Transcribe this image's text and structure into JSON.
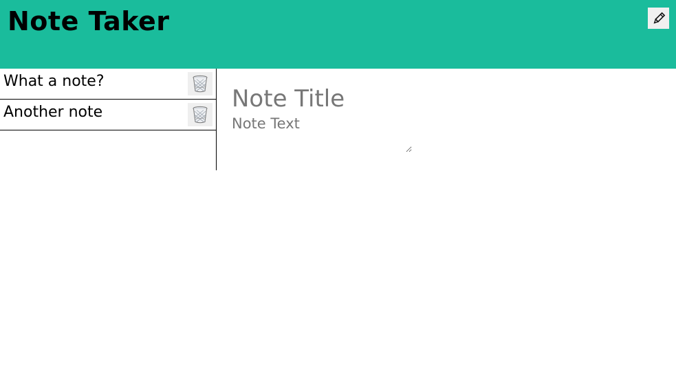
{
  "header": {
    "title": "Note Taker",
    "new_note_icon": "pencil-icon",
    "background": "#1abc9c"
  },
  "sidebar": {
    "notes": [
      {
        "title": "What a note?",
        "delete_icon": "trash-icon"
      },
      {
        "title": "Another note",
        "delete_icon": "trash-icon"
      }
    ]
  },
  "editor": {
    "title_placeholder": "Note Title",
    "text_placeholder": "Note Text"
  }
}
